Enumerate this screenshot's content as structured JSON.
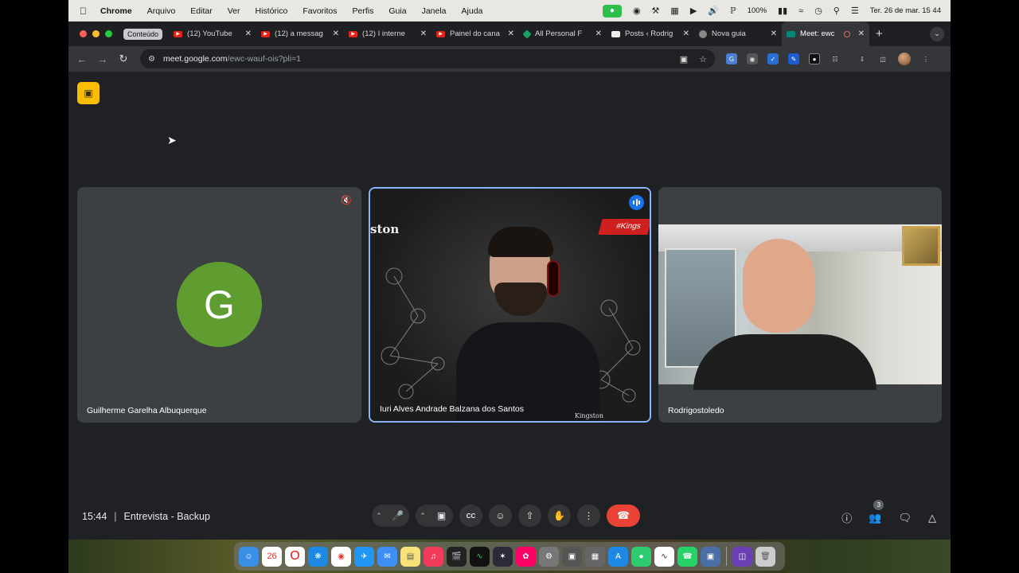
{
  "menubar": {
    "app_name": "Chrome",
    "menus": [
      "Arquivo",
      "Editar",
      "Ver",
      "Histórico",
      "Favoritos",
      "Perfis",
      "Guia",
      "Janela",
      "Ajuda"
    ],
    "battery": "100%",
    "datetime": "Ter. 26 de mar.  15 44"
  },
  "tabs": {
    "group_label": "Conteúdo",
    "items": [
      {
        "title": "(12) YouTube"
      },
      {
        "title": "(12) a messag"
      },
      {
        "title": "(12) I interne"
      },
      {
        "title": "Painel do cana"
      },
      {
        "title": "All Personal F"
      },
      {
        "title": "Posts ‹ Rodrig"
      },
      {
        "title": "Nova guia"
      },
      {
        "title": "Meet: ewc"
      }
    ],
    "new_tab": "+",
    "dropdown": "⌄"
  },
  "address": {
    "host": "meet.google.com",
    "path": "/ewc-wauf-ois?pli=1"
  },
  "meet": {
    "participants": [
      {
        "name": "Guilherme Garelha Albuquerque",
        "initial": "G"
      },
      {
        "name": "Iuri Alves Andrade Balzana dos Santos"
      },
      {
        "name": "Rodrigostoledo"
      }
    ],
    "video_brand_left": "ston",
    "video_brand_tag": "#Kings",
    "video_brand_small": "Kingston",
    "time": "15:44",
    "separator": "|",
    "meeting_title": "Entrevista - Backup",
    "people_count": "3"
  },
  "colors": {
    "meet_bg": "#202124",
    "tile_bg": "#3c4043",
    "avatar_green": "#5f9d31",
    "active_border": "#8ab4f8",
    "hangup_red": "#ea4335",
    "speaking_blue": "#1a73e8"
  }
}
